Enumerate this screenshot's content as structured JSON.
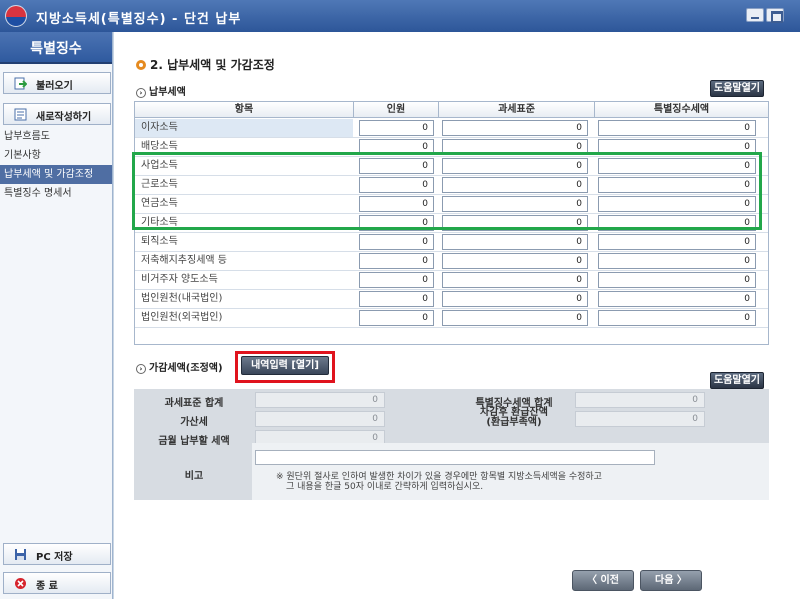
{
  "window": {
    "title": "지방소득세(특별징수) - 단건 납부"
  },
  "sidebar": {
    "header": "특별징수",
    "load_button": "불러오기",
    "new_button": "새로작성하기",
    "items": [
      "납부흐름도",
      "기본사항",
      "납부세액 및 가감조정",
      "특별징수 명세서"
    ],
    "active_index": 2,
    "save_button": "PC 저장",
    "exit_button": "종 료"
  },
  "main": {
    "section_title": "2. 납부세액 및 가감조정",
    "tax_subtitle": "납부세액",
    "help_label": "도움말열기",
    "columns": [
      "항목",
      "인원",
      "과세표준",
      "특별징수세액"
    ],
    "rows": [
      {
        "name": "이자소득",
        "values": [
          "0",
          "0",
          "0"
        ]
      },
      {
        "name": "배당소득",
        "values": [
          "0",
          "0",
          "0"
        ]
      },
      {
        "name": "사업소득",
        "values": [
          "0",
          "0",
          "0"
        ]
      },
      {
        "name": "근로소득",
        "values": [
          "0",
          "0",
          "0"
        ]
      },
      {
        "name": "연금소득",
        "values": [
          "0",
          "0",
          "0"
        ]
      },
      {
        "name": "기타소득",
        "values": [
          "0",
          "0",
          "0"
        ]
      },
      {
        "name": "퇴직소득",
        "values": [
          "0",
          "0",
          "0"
        ]
      },
      {
        "name": "저축해지추징세액 등",
        "values": [
          "0",
          "0",
          "0"
        ]
      },
      {
        "name": "비거주자 양도소득",
        "values": [
          "0",
          "0",
          "0"
        ]
      },
      {
        "name": "법인원천(내국법인)",
        "values": [
          "0",
          "0",
          "0"
        ]
      },
      {
        "name": "법인원천(외국법인)",
        "values": [
          "0",
          "0",
          "0"
        ]
      }
    ],
    "adjust_subtitle": "가감세액(조정액)",
    "open_detail_button": "내역입력 [열기]",
    "adjust": {
      "tax_base_total_label": "과세표준 합계",
      "tax_base_total": "0",
      "special_tax_total_label": "특별징수세액 합계",
      "special_tax_total": "0",
      "surcharge_label": "가산세",
      "surcharge": "0",
      "refund_label_line1": "차감후 환급잔액",
      "refund_label_line2": "(환급부족액)",
      "refund": "0",
      "payable_label": "금월 납부할 세액",
      "payable": "0",
      "remark_label": "비고",
      "note_line1": "※ 원단위 절사로 인하여 발생한 차이가 있을 경우에만 항목별 지방소득세액을 수정하고",
      "note_line2": "그 내용을 한글 50자 이내로 간략하게 입력하십시오."
    }
  },
  "footer": {
    "prev_button": "〈 이전",
    "next_button": "다음 〉"
  }
}
